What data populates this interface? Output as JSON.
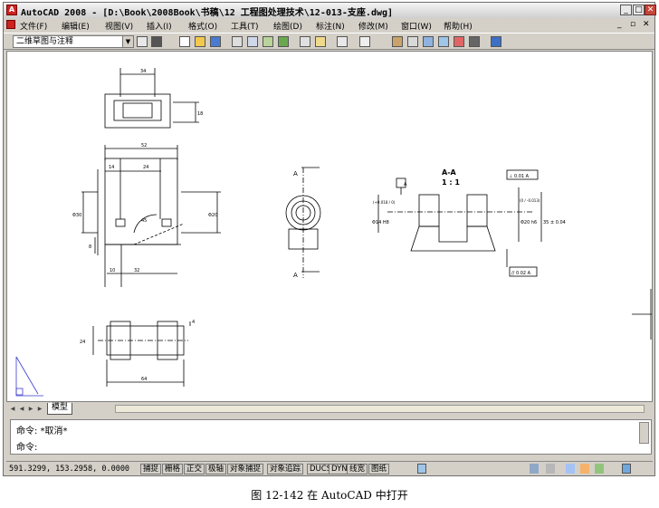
{
  "window": {
    "title": "AutoCAD 2008 - [D:\\Book\\2008Book\\书稿\\12 工程图处理技术\\12-013-支座.dwg]",
    "app_icon_text": "A",
    "minimize": "_",
    "maximize": "□",
    "close": "✕"
  },
  "menu": {
    "items": [
      "文件(F)",
      "编辑(E)",
      "视图(V)",
      "插入(I)",
      "格式(O)",
      "工具(T)",
      "绘图(D)",
      "标注(N)",
      "修改(M)",
      "窗口(W)",
      "帮助(H)"
    ],
    "doc_controls": [
      "_",
      "▫",
      "✕"
    ]
  },
  "toolbar": {
    "workspace": "二维草图与注释"
  },
  "drawing": {
    "dims": {
      "top_width": "34",
      "top_height": "18",
      "front_overall": "52",
      "front_left": "14",
      "front_slot": "24",
      "front_dia_left": "Φ30",
      "front_dia_right": "Φ20",
      "angle": "45",
      "base_h": "8",
      "base_left": "10",
      "base_mid": "32",
      "bottom_width": "64",
      "bottom_h": "24",
      "bottom_gap": "4",
      "sec_d1": "Φ14 H8",
      "sec_d2": "Φ20 h6",
      "sec_d3": "35 ± 0.04",
      "sec_tol1": "(+0.018 / 0)",
      "sec_tol2": "(0 / -0.013)",
      "gdt_top": "⊥ 0.01 A",
      "gdt_bottom": "// 0.02 A",
      "datum": "A"
    },
    "section_label": "A-A",
    "section_scale": "1 : 1",
    "cut_label_top": "A",
    "cut_label_bottom": "A"
  },
  "tabs": {
    "nav": [
      "◀",
      "◀",
      "▶",
      "▶"
    ],
    "model": "模型"
  },
  "command": {
    "history": "命令: *取消*",
    "prompt": "命令:"
  },
  "status": {
    "coordinates": "591.3299, 153.2958, 0.0000",
    "buttons": [
      "捕捉",
      "栅格",
      "正交",
      "极轴",
      "对象捕捉",
      "对象追踪",
      "DUCS",
      "DYN",
      "线宽",
      "图纸"
    ]
  },
  "caption": "图 12-142  在 AutoCAD 中打开"
}
